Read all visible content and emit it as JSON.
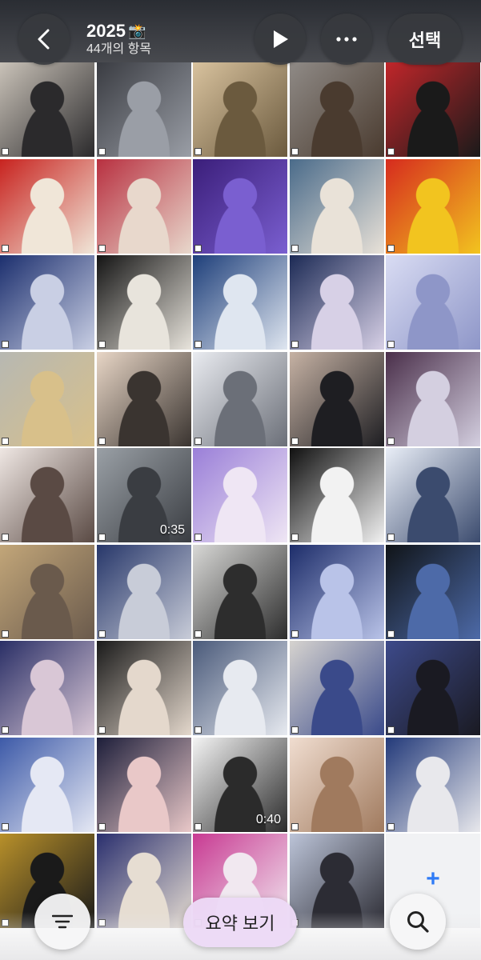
{
  "header": {
    "title": "2025",
    "title_emoji": "📸",
    "subtitle": "44개의 항목",
    "select_label": "선택",
    "icons": [
      "chevron-left-icon",
      "play-icon",
      "more-icon"
    ]
  },
  "grid": {
    "columns": 5,
    "photos": [
      {
        "c1": "#c9c2b8",
        "c2": "#2b2a2c"
      },
      {
        "c1": "#3a3c42",
        "c2": "#9a9ea6"
      },
      {
        "c1": "#d8c29e",
        "c2": "#6b5a3e"
      },
      {
        "c1": "#8f8a86",
        "c2": "#4a3b2f"
      },
      {
        "c1": "#c0262a",
        "c2": "#1a1a1a"
      },
      {
        "c1": "#c8231f",
        "c2": "#f0e6d8"
      },
      {
        "c1": "#b83040",
        "c2": "#e8d8cc"
      },
      {
        "c1": "#3b1e7a",
        "c2": "#7a5fd0"
      },
      {
        "c1": "#4a6b8a",
        "c2": "#e9e2d8"
      },
      {
        "c1": "#d62b1e",
        "c2": "#f2c41f"
      },
      {
        "c1": "#1c2f6e",
        "c2": "#c9cfe4"
      },
      {
        "c1": "#141414",
        "c2": "#e8e4dc"
      },
      {
        "c1": "#1e3f7a",
        "c2": "#dfe6f0"
      },
      {
        "c1": "#1c2a55",
        "c2": "#d7d0e6"
      },
      {
        "c1": "#d9dcf3",
        "c2": "#8e96c8"
      },
      {
        "c1": "#b7b8b2",
        "c2": "#d8c08a"
      },
      {
        "c1": "#e8d6c6",
        "c2": "#3a3430"
      },
      {
        "c1": "#e9ebf0",
        "c2": "#6b6f78"
      },
      {
        "c1": "#c6b2a4",
        "c2": "#1e1e22"
      },
      {
        "c1": "#4a2f4a",
        "c2": "#d4cfe0"
      },
      {
        "c1": "#efe7e3",
        "c2": "#5a4a44"
      },
      {
        "c1": "#9aa0a6",
        "c2": "#3a3d42"
      },
      {
        "c1": "#9a7fd8",
        "c2": "#efe6f4"
      },
      {
        "c1": "#101010",
        "c2": "#f2f2f2"
      },
      {
        "c1": "#e9eef7",
        "c2": "#3b4b6e"
      },
      {
        "c1": "#c2a679",
        "c2": "#6a5a4c"
      },
      {
        "c1": "#27376a",
        "c2": "#c8ccd8"
      },
      {
        "c1": "#d8d8d6",
        "c2": "#2d2d2d"
      },
      {
        "c1": "#1d2d6a",
        "c2": "#b9c3e8"
      },
      {
        "c1": "#101418",
        "c2": "#4d6aa8"
      },
      {
        "c1": "#2a2f66",
        "c2": "#d9c7d6"
      },
      {
        "c1": "#1a1a1a",
        "c2": "#e4d8cc"
      },
      {
        "c1": "#4a5a7a",
        "c2": "#e7eaf0"
      },
      {
        "c1": "#d6d3cf",
        "c2": "#3a4a8a"
      },
      {
        "c1": "#3d4a8a",
        "c2": "#1a1a22"
      },
      {
        "c1": "#3d5aa8",
        "c2": "#e5e8f4"
      },
      {
        "c1": "#1d1e3a",
        "c2": "#e9c8c8"
      },
      {
        "c1": "#f4f4f4",
        "c2": "#2b2b2b"
      },
      {
        "c1": "#f0ddd0",
        "c2": "#a07a5e"
      },
      {
        "c1": "#233a7a",
        "c2": "#e8e8ec"
      },
      {
        "c1": "#b8902a",
        "c2": "#1a1a1a"
      },
      {
        "c1": "#2a2f6e",
        "c2": "#e6ddd2"
      },
      {
        "c1": "#c83a92",
        "c2": "#f1e8f0"
      },
      {
        "c1": "#bcc4d8",
        "c2": "#2c2c34"
      }
    ],
    "durations": {
      "21": "0:35",
      "37": "0:40"
    },
    "add_icon": "+"
  },
  "bottom": {
    "summary_label": "요약 보기",
    "icons": [
      "filter-icon",
      "search-icon"
    ]
  }
}
